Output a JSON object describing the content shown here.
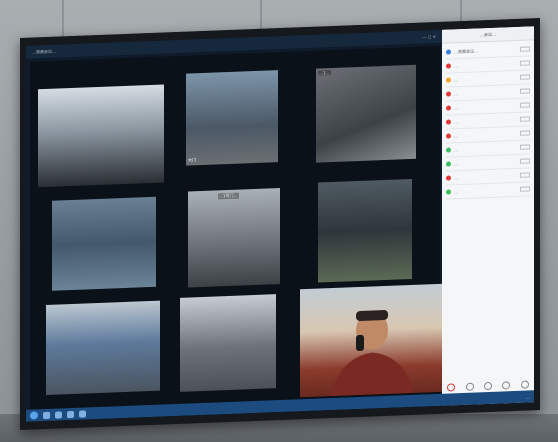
{
  "window": {
    "title": "…视频会议…"
  },
  "wall": {
    "tiles": [
      {
        "id": "t1",
        "label": "",
        "tag": ""
      },
      {
        "id": "t2",
        "label": "",
        "tag": "大门"
      },
      {
        "id": "t3",
        "label": "…1…",
        "tag": ""
      },
      {
        "id": "t4",
        "label": "",
        "tag": ""
      },
      {
        "id": "t5",
        "label": "…1号门…",
        "tag": "大门"
      },
      {
        "id": "t6",
        "label": "",
        "tag": ""
      },
      {
        "id": "t7",
        "label": "",
        "tag": ""
      },
      {
        "id": "t8",
        "label": "",
        "tag": ""
      },
      {
        "id": "t9",
        "label": "",
        "tag": ""
      }
    ]
  },
  "panel": {
    "title": "…会议…",
    "participants": [
      {
        "name": "…视频会议…",
        "color": "#3d7fe0"
      },
      {
        "name": "…",
        "color": "#e23b3b"
      },
      {
        "name": "…",
        "color": "#f2a12b"
      },
      {
        "name": "…",
        "color": "#e23b3b"
      },
      {
        "name": "…",
        "color": "#e23b3b"
      },
      {
        "name": "…",
        "color": "#e23b3b"
      },
      {
        "name": "…",
        "color": "#e23b3b"
      },
      {
        "name": "…",
        "color": "#3cbf62"
      },
      {
        "name": "…",
        "color": "#3cbf62"
      },
      {
        "name": "…",
        "color": "#e23b3b"
      },
      {
        "name": "…",
        "color": "#3cbf62"
      }
    ]
  },
  "taskbar": {
    "clock": "…"
  },
  "colors": {
    "bezel": "#15181c",
    "taskbar": "#1c4b80",
    "panel": "#f4f6f8"
  }
}
